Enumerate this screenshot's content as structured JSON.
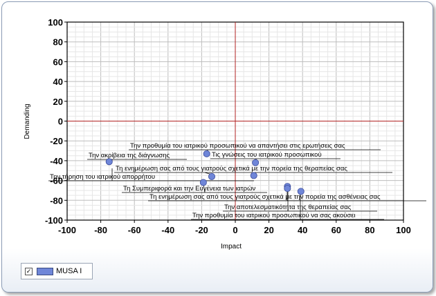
{
  "chart_data": {
    "type": "scatter",
    "xlabel": "Impact",
    "ylabel": "Demanding",
    "xlim": [
      -100,
      100
    ],
    "ylim": [
      -100,
      100
    ],
    "x_ticks": [
      "-100",
      "-80",
      "-60",
      "-40",
      "-20",
      "0",
      "20",
      "40",
      "60",
      "80",
      "100"
    ],
    "y_ticks": [
      "100",
      "80",
      "60",
      "40",
      "20",
      "0",
      "-20",
      "-40",
      "-60",
      "-80",
      "-100"
    ],
    "grid": true,
    "legend_position": "bottom-left",
    "series": [
      {
        "name": "MUSA I",
        "color": "#6f86d8",
        "points": [
          {
            "x": -75,
            "y": -41,
            "label": "Την ακρίβεια της διάγνωσης"
          },
          {
            "x": -17,
            "y": -33,
            "label": "Την προθυμία του ιατρικού προσωπικού να απαντήσει στις ερωτήσεις σας"
          },
          {
            "x": 12,
            "y": -42,
            "label": "Τις γνώσεις του ιατρικού προσωπικού"
          },
          {
            "x": -14,
            "y": -56,
            "label": "Τη ενημέρωση σας από τους γιατρούς σχετικά με την πορεία της θεραπείας σας"
          },
          {
            "x": 11,
            "y": -55,
            "label": "Την τήρηση του ιατρικού απορρήτου"
          },
          {
            "x": -19,
            "y": -62,
            "label": "Τη Συμπεριφορά και την Ευγένεια των ιατρών"
          },
          {
            "x": 31,
            "y": -66,
            "label": "Τη ενημέρωση σας από τους γιατρούς σχετικά με την πορεία της ασθένειας σας"
          },
          {
            "x": 31,
            "y": -68,
            "label": "Την αποτελεσματικότητα της θεραπείας σας"
          },
          {
            "x": 39,
            "y": -71,
            "label": "Την προθυμία του ιατρικού προσωπικού να σας ακούσει"
          }
        ]
      }
    ]
  },
  "legend": {
    "check": "✓",
    "label": "MUSA I"
  }
}
